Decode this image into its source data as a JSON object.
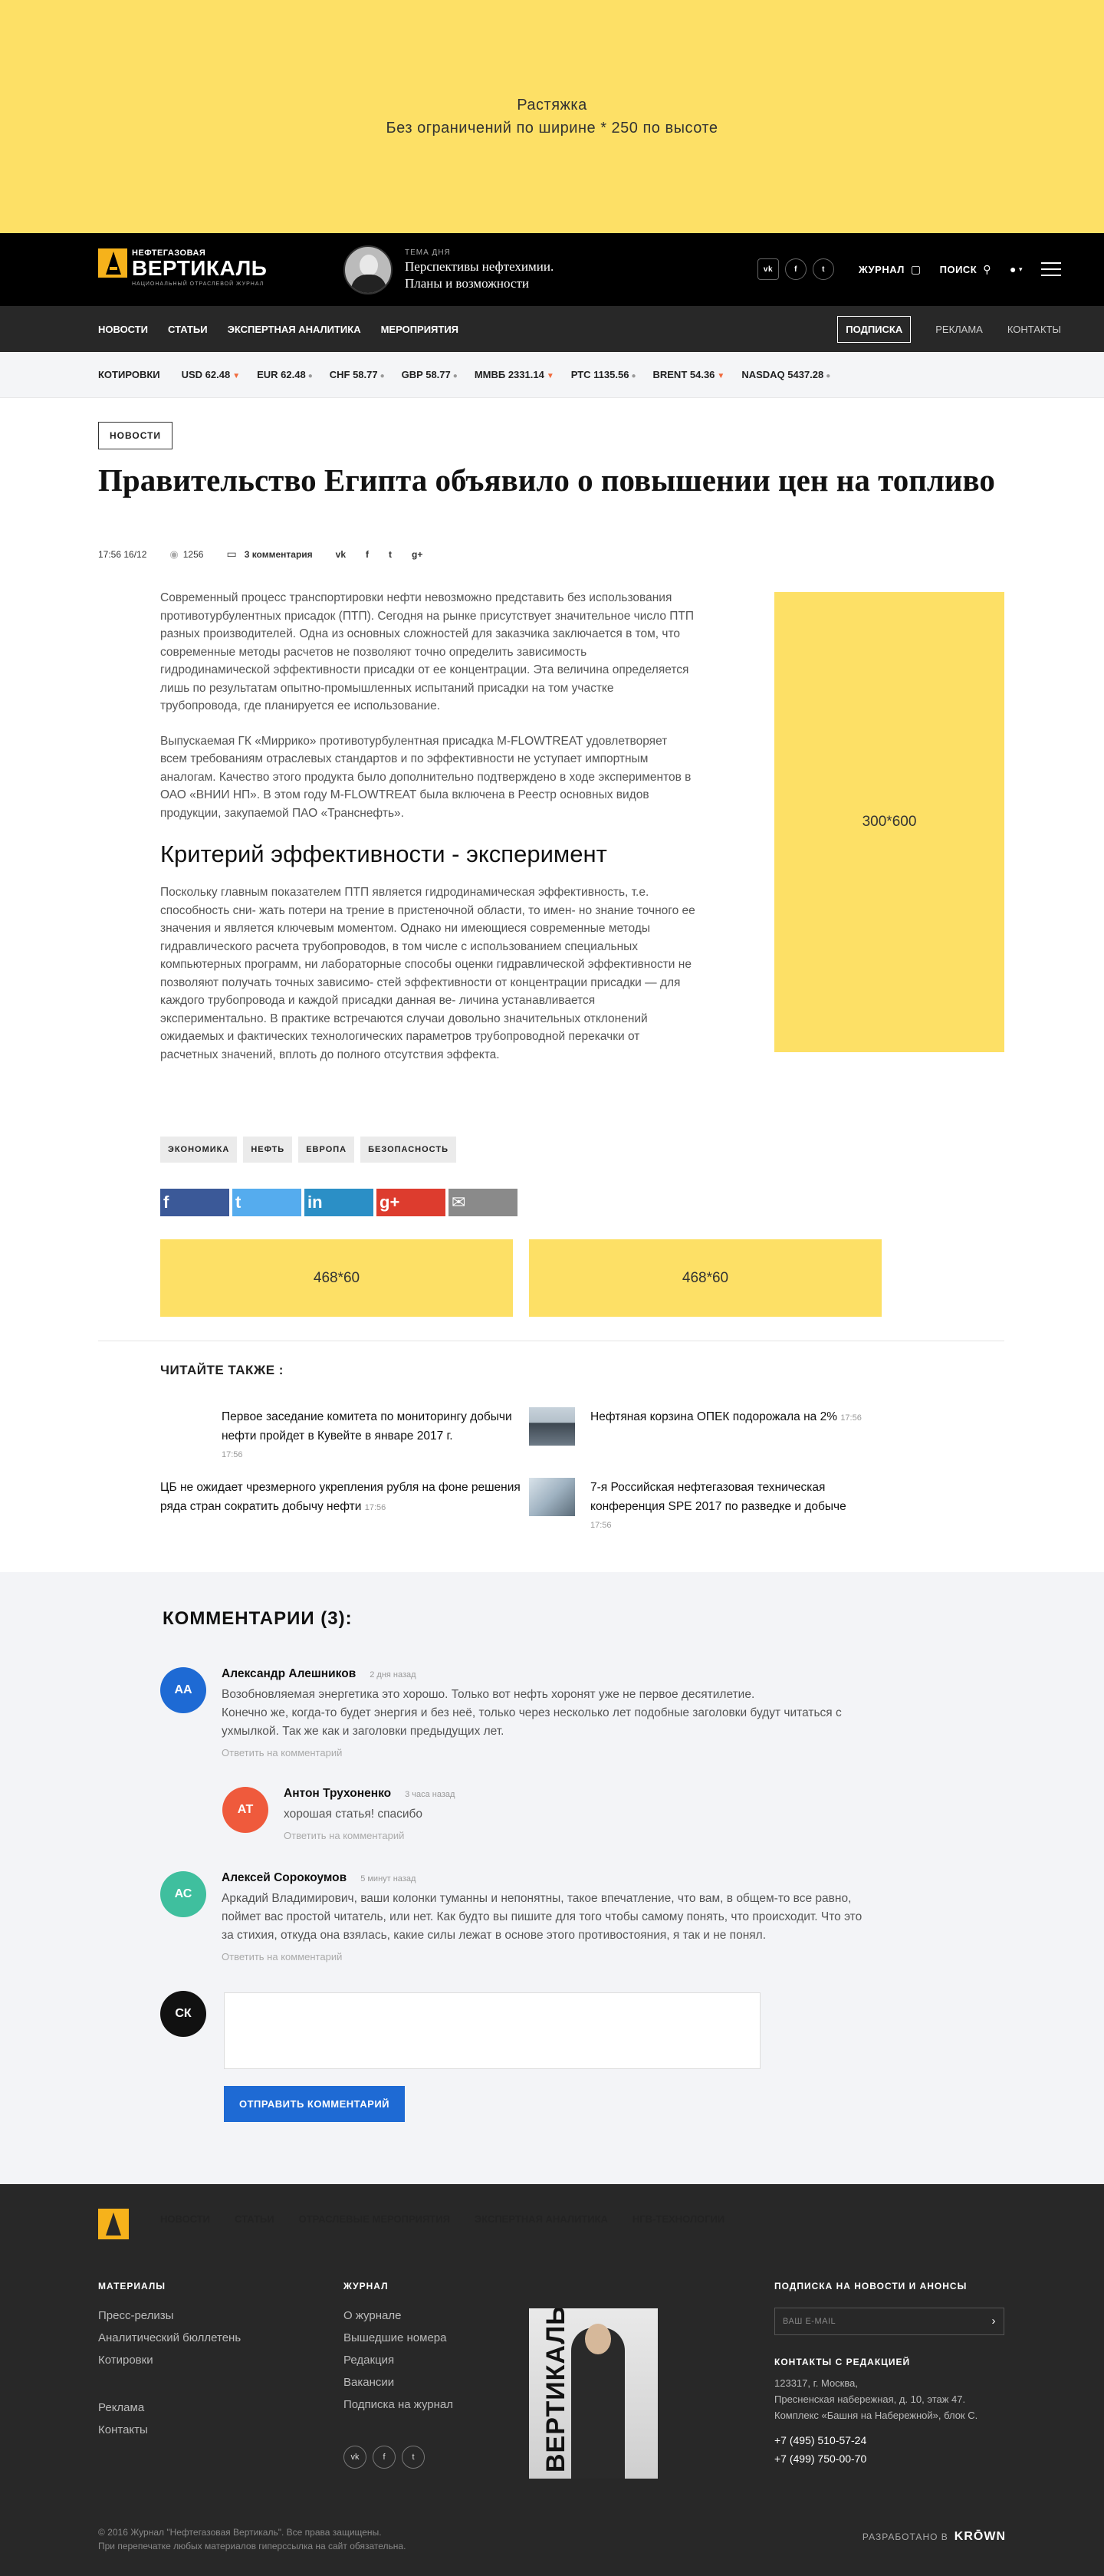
{
  "banner_top": {
    "line1": "Растяжка",
    "line2": "Без ограничений по ширине * 250 по высоте"
  },
  "header": {
    "logo": {
      "line1": "НЕФТЕГАЗОВАЯ",
      "line2": "ВЕРТИКАЛЬ",
      "line3": "НАЦИОНАЛЬНЫЙ ОТРАСЛЕВОЙ ЖУРНАЛ"
    },
    "topic_label": "ТЕМА ДНЯ",
    "topic_title_1": "Перспективы нефтехимии.",
    "topic_title_2": "Планы и возможности",
    "social": [
      "vk",
      "f",
      "t"
    ],
    "journal_label": "ЖУРНАЛ",
    "search_label": "ПОИСК"
  },
  "nav": {
    "items": [
      "НОВОСТИ",
      "СТАТЬИ",
      "ЭКСПЕРТНАЯ АНАЛИТИКА",
      "МЕРОПРИЯТИЯ"
    ],
    "subscribe": "ПОДПИСКА",
    "ads": "РЕКЛАМА",
    "contacts": "КОНТАКТЫ"
  },
  "quotes": {
    "label": "КОТИРОВКИ",
    "items": [
      {
        "text": "USD 62.48",
        "trend": "down"
      },
      {
        "text": "EUR 62.48",
        "trend": "neutral"
      },
      {
        "text": "CHF 58.77",
        "trend": "neutral"
      },
      {
        "text": "GBP 58.77",
        "trend": "neutral"
      },
      {
        "text": "ММВБ 2331.14",
        "trend": "down"
      },
      {
        "text": "РТС 1135.56",
        "trend": "neutral"
      },
      {
        "text": "BRENT 54.36",
        "trend": "down"
      },
      {
        "text": "NASDAQ 5437.28",
        "trend": "neutral"
      }
    ]
  },
  "article": {
    "category": "НОВОСТИ",
    "title": "Правительство Египта объявило о повышении цен на топливо",
    "datetime": "17:56 16/12",
    "views": "1256",
    "comments_link": "3 комментария",
    "share_icons": [
      "vk",
      "f",
      "t",
      "g+"
    ],
    "paragraph1": "Современный процесс транспортировки нефти невозможно представить без использования противотурбулентных присадок (ПТП). Сегодня на рынке присутствует значительное число ПТП разных производителей. Одна из основных сложностей для заказчика заключается в том, что современные методы расчетов не позволяют точно определить зависимость гидродинамической эффективности присадки от ее концентрации. Эта величина определяется лишь по результатам опытно-промышленных испытаний присадки на том участке трубопровода, где планируется ее использование.",
    "paragraph2": "Выпускаемая ГК «Миррико» противотурбулентная присадка M-FLOWTREAT удовлетворяет всем требованиям отраслевых стандартов и по эффективности не уступает импортным аналогам. Качество этого продукта было дополнительно подтверждено в ходе экспериментов в ОАО «ВНИИ НП». В этом году M-FLOWTREAT была включена в Реестр основных видов продукции, закупаемой ПАО «Транснефть».",
    "subheading": "Критерий эффективности - эксперимент",
    "paragraph3": "Поскольку главным показателем ПТП является гидродинамическая эффективность, т.е. способность сни- жать потери на трение в пристеночной области, то имен- но знание точного ее значения и является ключевым моментом. Однако ни имеющиеся современные методы гидравлического расчета трубопроводов, в том числе с использованием специальных компьютерных программ, ни лабораторные способы оценки гидравлической эффективности не позволяют получать точных зависимо- стей эффективности от концентрации присадки — для каждого трубопровода и каждой присадки данная ве- личина устанавливается экспериментально. В практике встречаются случаи довольно значительных отклонений ожидаемых и фактических технологических параметров трубопроводной перекачки от расчетных значений, вплоть до полного отсутствия эффекта.",
    "side_ad": "300*600",
    "tags": [
      "ЭКОНОМИКА",
      "НЕФТЬ",
      "ЕВРОПА",
      "БЕЗОПАСНОСТЬ"
    ],
    "share_buttons": [
      {
        "glyph": "f",
        "color": "#3b5998"
      },
      {
        "glyph": "t",
        "color": "#55acee"
      },
      {
        "glyph": "in",
        "color": "#2b8fc6"
      },
      {
        "glyph": "g+",
        "color": "#dd3c2e"
      },
      {
        "glyph": "✉",
        "color": "#8a8a8a"
      }
    ],
    "ad1": "468*60",
    "ad2": "468*60"
  },
  "read_also": {
    "title": "ЧИТАЙТЕ ТАКЖЕ :",
    "items": [
      {
        "text": "Первое заседание комитета по мониторингу добычи нефти пройдет в Кувейте в январе 2017 г.",
        "time": "17:56"
      },
      {
        "text": "Нефтяная корзина ОПЕК подорожала на 2%",
        "time": "17:56"
      },
      {
        "text": "ЦБ не ожидает чрезмерного укрепления рубля на фоне решения ряда стран сократить добычу нефти",
        "time": "17:56"
      },
      {
        "text": "7-я Российская нефтегазовая техническая конференция SPE 2017 по разведке и добыче",
        "time": "17:56"
      }
    ]
  },
  "comments": {
    "title": "КОММЕНТАРИИ (3):",
    "reply_label": "Ответить на комментарий",
    "items": [
      {
        "initials": "АА",
        "color": "#1e6ad4",
        "name": "Александр Алешников",
        "time": "2 дня назад",
        "text_line1": "Возобновляемая энергетика это хорошо. Только вот нефть хоронят уже не первое десятилетие.",
        "text_line2": "Конечно же, когда-то будет энергия и без неё, только через несколько лет подобные заголовки будут читаться с ухмылкой. Так же как и заголовки предыдущих лет."
      },
      {
        "initials": "АТ",
        "color": "#ef5a3c",
        "name": "Антон Трухоненко",
        "time": "3 часа назад",
        "text_line1": "хорошая статья! спасибо"
      },
      {
        "initials": "АС",
        "color": "#3fbf9e",
        "name": "Алексей Сорокоумов",
        "time": "5 минут назад",
        "text_line1": "Аркадий Владимирович, ваши колонки туманны и непонятны, такое впечатление, что вам, в общем-то все равно, поймет вас простой читатель, или нет. Как будто вы пишите для того чтобы самому понять, что происходит. Что это за стихия, откуда она взялась, какие силы лежат в основе этого противостояния, я так и не понял."
      }
    ],
    "form_initials": "СК",
    "send_label": "ОТПРАВИТЬ КОММЕНТАРИЙ"
  },
  "footer": {
    "nav": [
      "НОВОСТИ",
      "СТАТЬИ",
      "ОТРАСЛЕВЫЕ МЕРОПРИЯТИЯ",
      "ЭКСПЕРТНАЯ АНАЛИТИКА",
      "НГВ-ТЕХНОЛОГИИ"
    ],
    "materials_title": "МАТЕРИАЛЫ",
    "materials": [
      "Пресс-релизы",
      "Аналитический бюллетень",
      "Котировки"
    ],
    "materials2": [
      "Реклама",
      "Контакты"
    ],
    "journal_title": "ЖУРНАЛ",
    "journal": [
      "О журнале",
      "Вышедшие номера",
      "Редакция",
      "Вакансии",
      "Подписка на журнал"
    ],
    "magazine_cover_text": "ВЕРТИКАЛЬ",
    "subscribe_title": "ПОДПИСКА НА НОВОСТИ И АНОНСЫ",
    "email_placeholder": "ВАШ E-MAIL",
    "contacts_title": "КОНТАКТЫ С РЕДАКЦИЕЙ",
    "address1": "123317, г. Москва,",
    "address2": "Пресненская набережная, д. 10, этаж 47.",
    "address3": "Комплекс «Башня на Набережной», блок С.",
    "phone1": "+7 (495) 510-57-24",
    "phone2": "+7 (499) 750-00-70",
    "copyright1": "© 2016 Журнал \"Нефтегазовая Вертикаль\". Все права защищены.",
    "copyright2": "При перепечатке любых материалов гиперссылка на сайт обязательна.",
    "dev_label": "РАЗРАБОТАНО В",
    "dev_name": "KRŌWN"
  }
}
